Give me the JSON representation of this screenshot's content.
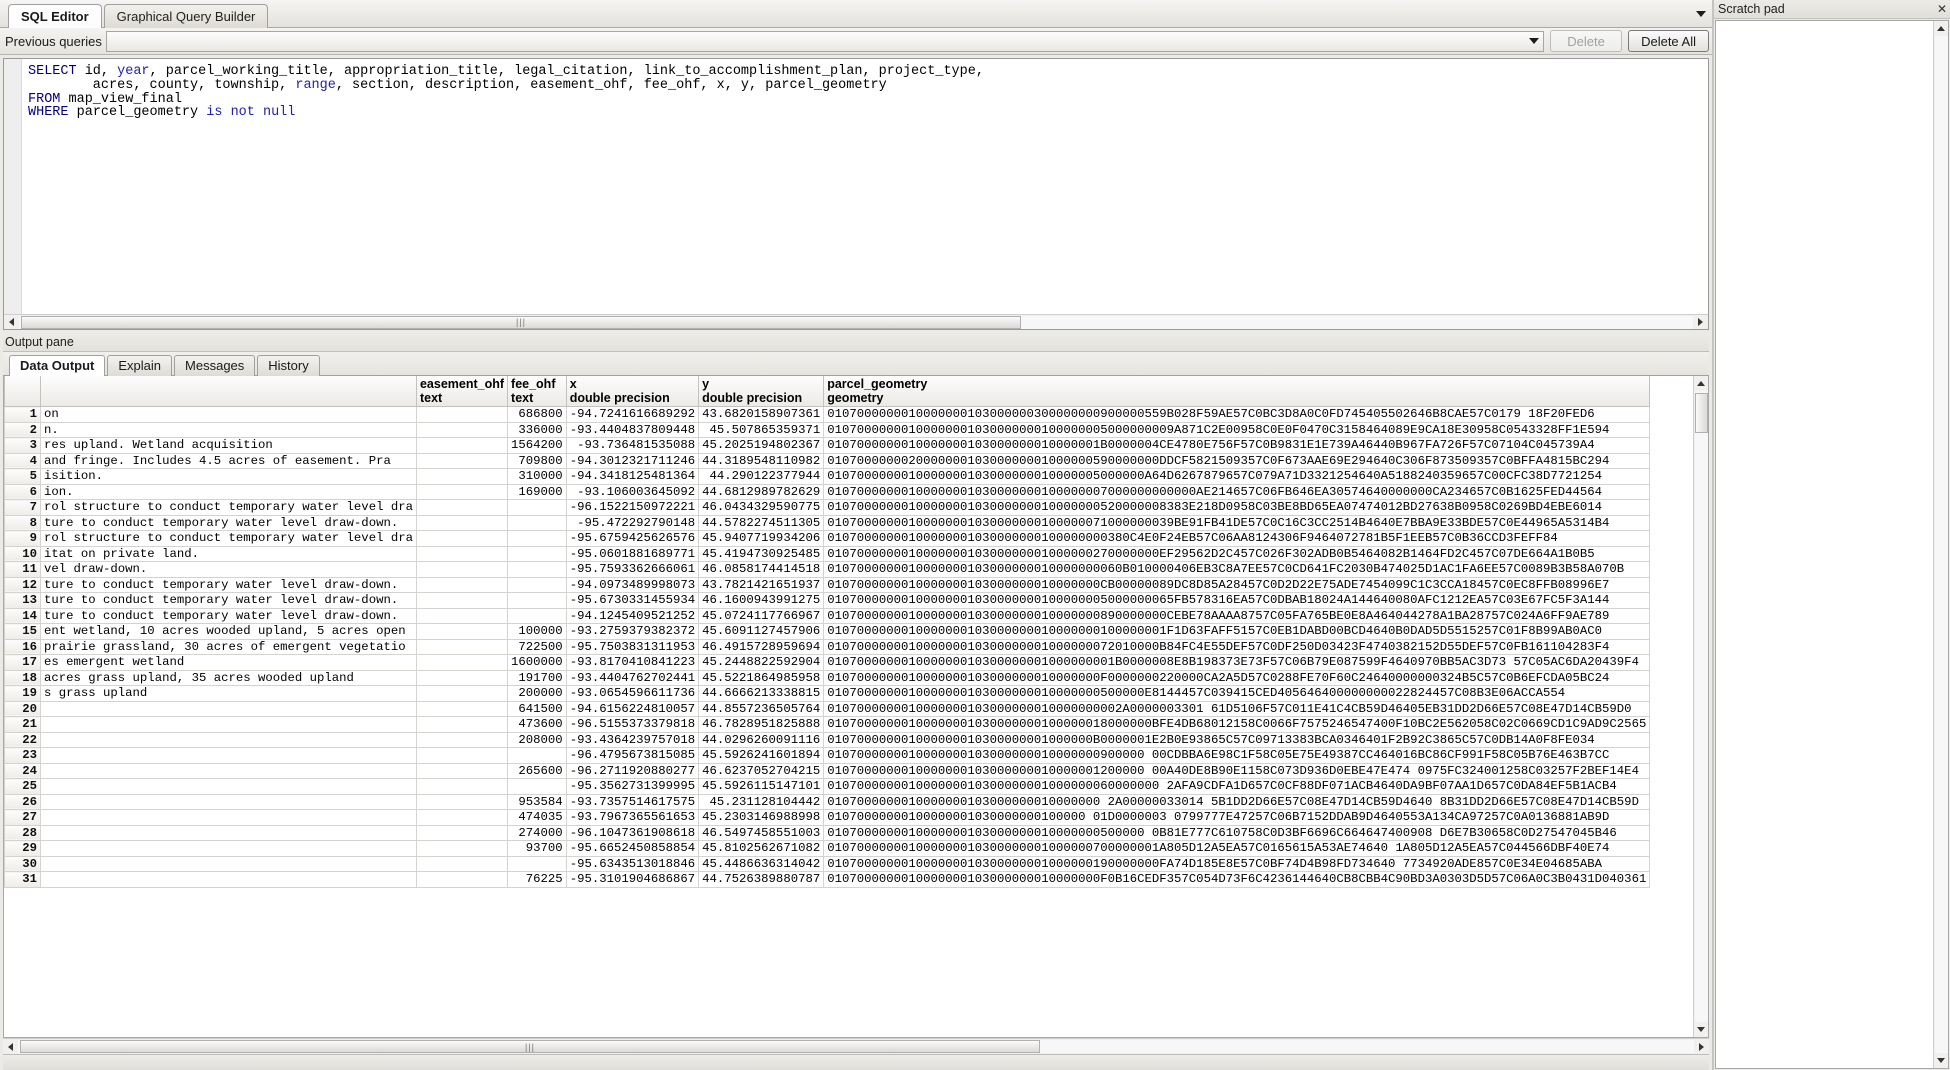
{
  "window": {
    "tabs": [
      {
        "label": "SQL Editor",
        "active": true
      },
      {
        "label": "Graphical Query Builder",
        "active": false
      }
    ],
    "tab_overflow_icon": "chevron-down-icon"
  },
  "toolbar": {
    "previous_queries_label": "Previous queries",
    "previous_queries_value": "",
    "dropdown_icon": "chevron-down-icon",
    "delete_label": "Delete",
    "delete_all_label": "Delete All"
  },
  "editor": {
    "lines": [
      [
        {
          "t": "SELECT",
          "c": "kw"
        },
        {
          "t": " id, ",
          "c": ""
        },
        {
          "t": "year",
          "c": "kw2"
        },
        {
          "t": ", parcel_working_title, appropriation_title, legal_citation, link_to_accomplishment_plan, project_type,",
          "c": ""
        }
      ],
      [
        {
          "t": "        acres, county, township, ",
          "c": ""
        },
        {
          "t": "range",
          "c": "kw2"
        },
        {
          "t": ", section, description, easement_ohf, fee_ohf, x, y, parcel_geometry",
          "c": ""
        }
      ],
      [
        {
          "t": "FROM",
          "c": "kw"
        },
        {
          "t": " map_view_final",
          "c": ""
        }
      ],
      [
        {
          "t": "WHERE",
          "c": "kw"
        },
        {
          "t": " parcel_geometry ",
          "c": ""
        },
        {
          "t": "is",
          "c": "kw2"
        },
        {
          "t": " ",
          "c": ""
        },
        {
          "t": "not",
          "c": "kw2"
        },
        {
          "t": " ",
          "c": ""
        },
        {
          "t": "null",
          "c": "kw2"
        }
      ]
    ],
    "scroll_grip": "|||"
  },
  "output": {
    "pane_title": "Output pane",
    "tabs": [
      {
        "label": "Data Output",
        "active": true
      },
      {
        "label": "Explain",
        "active": false
      },
      {
        "label": "Messages",
        "active": false
      },
      {
        "label": "History",
        "active": false
      }
    ]
  },
  "grid": {
    "columns": [
      {
        "name": "",
        "type": ""
      },
      {
        "name": "",
        "type": ""
      },
      {
        "name": "easement_ohf",
        "type": "text"
      },
      {
        "name": "fee_ohf",
        "type": "text"
      },
      {
        "name": "x",
        "type": "double precision"
      },
      {
        "name": "y",
        "type": "double precision"
      },
      {
        "name": "parcel_geometry",
        "type": "geometry"
      }
    ],
    "rows": [
      {
        "n": "1",
        "desc": "on",
        "easement": "",
        "fee": "686800",
        "x": "-94.7241616689292",
        "y": "43.6820158907361",
        "geom": "0107000000010000000103000000300000000900000559B028F59AE57C0BC3D8A0C0FD745405502646B8CAE57C0179 18F20FED6"
      },
      {
        "n": "2",
        "desc": "n.",
        "easement": "",
        "fee": "336000",
        "x": "-93.4404837809448",
        "y": "45.507865359371",
        "geom": "01070000000100000001030000000100000005000000009A871C2E00958C0E0F0470C3158464089E9CA18E30958C0543328FF1E594"
      },
      {
        "n": "3",
        "desc": "res upland.  Wetland acquisition",
        "easement": "",
        "fee": "1564200",
        "x": "-93.736481535088",
        "y": "45.2025194802367",
        "geom": "0107000000010000000103000000010000001B0000004CE4780E756F57C0B9831E1E739A46440B967FA726F57C07104C045739A4"
      },
      {
        "n": "4",
        "desc": "and fringe.  Includes 4.5 acres of easement.  Pra",
        "easement": "",
        "fee": "709800",
        "x": "-94.3012321711246",
        "y": "44.3189548110982",
        "geom": "010700000002000000010300000001000000590000000DDCF5821509357C0F673AAE69E294640C306F873509357C0BFFA4815BC294"
      },
      {
        "n": "5",
        "desc": "isition.",
        "easement": "",
        "fee": "310000",
        "x": "-94.3418125481364",
        "y": "44.290122377944",
        "geom": "0107000000010000000103000000010000005000000A64D6267879657C079A71D3321254640A5188240359657C00CFC38D7721254"
      },
      {
        "n": "6",
        "desc": "ion.",
        "easement": "",
        "fee": "169000",
        "x": "-93.106003645092",
        "y": "44.6812989782629",
        "geom": "01070000000100000001030000000100000007000000000000AE214657C06FB646EA30574640000000CA234657C0B1625FED44564"
      },
      {
        "n": "7",
        "desc": "rol structure to conduct temporary water level dra",
        "easement": "",
        "fee": "",
        "x": "-96.1522150972221",
        "y": "46.0434329590775",
        "geom": "0107000000010000000103000000010000000520000008383E218D0958C03BE8BD65EA07474012BD27638B0958C0269BD4EBE6014"
      },
      {
        "n": "8",
        "desc": "ture to conduct temporary water level draw-down.",
        "easement": "",
        "fee": "",
        "x": "-95.472292790148",
        "y": "44.5782274511305",
        "geom": "01070000000100000001030000000100000071000000039BE91FB41DE57C0C16C3CC2514B4640E7BBA9E33BDE57C0E44965A5314B4"
      },
      {
        "n": "9",
        "desc": "rol structure to conduct temporary water level dra",
        "easement": "",
        "fee": "",
        "x": "-95.6759425626576",
        "y": "45.9407719934206",
        "geom": "01070000000100000001030000000100000000380C4E0F24EB57C06AA8124306F9464072781B5F1EEB57C0B36CCD3FEFF84"
      },
      {
        "n": "10",
        "desc": "itat on private land.",
        "easement": "",
        "fee": "",
        "x": "-95.0601881689771",
        "y": "45.4194730925485",
        "geom": "010700000001000000010300000001000000270000000EF29562D2C457C026F302ADB0B5464082B1464FD2C457C07DE664A1B0B5"
      },
      {
        "n": "11",
        "desc": "vel draw-down.",
        "easement": "",
        "fee": "",
        "x": "-95.7593362666061",
        "y": "46.0858174414518",
        "geom": "0107000000010000000103000000010000000060B010000406EB3C8A7EE57C0CD641FC2030B474025D1AC1FA6EE57C0089B3B58A070B"
      },
      {
        "n": "12",
        "desc": "ture to conduct temporary water level draw-down.",
        "easement": "",
        "fee": "",
        "x": "-94.0973489998073",
        "y": "43.7821421651937",
        "geom": "0107000000010000000103000000010000000CB00000089DC8D85A28457C0D2D22E75ADE7454099C1C3CCA18457C0EC8FFB08996E7"
      },
      {
        "n": "13",
        "desc": "ture to conduct temporary water level draw-down.",
        "easement": "",
        "fee": "",
        "x": "-95.6730331455934",
        "y": "46.1600943991275",
        "geom": "01070000000100000001030000000100000005000000065FB578316EA57C0DBAB18024A144640080AFC1212EA57C03E67FC5F3A144"
      },
      {
        "n": "14",
        "desc": "ture to conduct temporary water level draw-down.",
        "easement": "",
        "fee": "",
        "x": "-94.1245409521252",
        "y": "45.0724117766967",
        "geom": "0107000000010000000103000000010000000890000000CEBE78AAAA8757C05FA765BE0E8A464044278A1BA28757C024A6FF9AE789"
      },
      {
        "n": "15",
        "desc": "ent wetland, 10 acres wooded upland, 5 acres open",
        "easement": "",
        "fee": "100000",
        "x": "-93.2759379382372",
        "y": "45.6091127457906",
        "geom": "0107000000010000000103000000010000000100000001F1D63FAFF5157C0EB1DABD00BCD4640B0DAD5D5515257C01F8B99AB0AC0"
      },
      {
        "n": "16",
        "desc": " prairie grassland, 30 acres of emergent vegetatio",
        "easement": "",
        "fee": "722500",
        "x": "-95.7503831311953",
        "y": "46.4915728959694",
        "geom": "010700000001000000010300000001000000072010000B84FC4E55DEF57C0DF250D03423F4740382152D55DEF57C0FB161104283F4"
      },
      {
        "n": "17",
        "desc": "es emergent wetland",
        "easement": "",
        "fee": "1600000",
        "x": "-93.8170410841223",
        "y": "45.2448822592904",
        "geom": "010700000001000000010300000001000000001B0000008E8B198373E73F57C06B79E087599F4640970BB5AC3D73 57C05AC6DA20439F4"
      },
      {
        "n": "18",
        "desc": "acres grass upland, 35 acres wooded upland",
        "easement": "",
        "fee": "191700",
        "x": "-93.4404762702441",
        "y": "45.5221864985958",
        "geom": "0107000000010000000103000000010000000F0000000220000CA2A5D57C0288FE70F60C24640000000324B5C57C0B6EFCDA05BC24"
      },
      {
        "n": "19",
        "desc": "s grass upland",
        "easement": "",
        "fee": "200000",
        "x": "-93.0654596611736",
        "y": "44.6666213338815",
        "geom": "0107000000010000000103000000010000000500000E8144457C039415CED405646400000000022824457C08B3E06ACCA554"
      },
      {
        "n": "20",
        "desc": "",
        "easement": "",
        "fee": "641500",
        "x": "-94.6156224810057",
        "y": "44.8557236505764",
        "geom": "0107000000010000000103000000010000000002A0000003301 61D5106F57C011E41C4CB59D46405EB31DD2D66E57C08E47D14CB59D0"
      },
      {
        "n": "21",
        "desc": "",
        "easement": "",
        "fee": "473600",
        "x": "-96.5155373379818",
        "y": "46.7828951825888",
        "geom": "01070000000100000001030000000100000018000000BFE4DB68012158C0066F7575246547400F10BC2E562058C02C0669CD1C9AD9C2565"
      },
      {
        "n": "22",
        "desc": "",
        "easement": "",
        "fee": "208000",
        "x": "-93.4364239757018",
        "y": "44.0296260091116",
        "geom": "010700000001000000010300000001000000B0000001E2B0E93865C57C09713383BCA0346401F2B92C3865C57C0DB14A0F8FE034"
      },
      {
        "n": "23",
        "desc": "",
        "easement": "",
        "fee": "",
        "x": "-96.4795673815085",
        "y": "45.5926241601894",
        "geom": "0107000000010000000103000000010000000900000 00CDBBA6E98C1F58C05E75E49387CC464016BC86CF991F58C05B76E463B7CC"
      },
      {
        "n": "24",
        "desc": "",
        "easement": "",
        "fee": "265600",
        "x": "-96.2711920880277",
        "y": "46.6237052704215",
        "geom": "0107000000010000000103000000010000001200000 00A40DE8B90E1158C073D936D0EBE47E474 0975FC324001258C03257F2BEF14E4"
      },
      {
        "n": "25",
        "desc": "",
        "easement": "",
        "fee": "",
        "x": "-95.3562731399995",
        "y": "45.5926115147101",
        "geom": "010700000001000000010300000001000000060000000 2AFA9CDFA1D657C0CF88DF071ACB4640DA9BF07AA1D657C0DA84EF5B1ACB4"
      },
      {
        "n": "26",
        "desc": "",
        "easement": "",
        "fee": "953584",
        "x": "-93.7357514617575",
        "y": "45.231128104442",
        "geom": "0107000000010000000103000000010000000 2A00000033014 5B1DD2D66E57C08E47D14CB59D4640 8B31DD2D66E57C08E47D14CB59D"
      },
      {
        "n": "27",
        "desc": "",
        "easement": "",
        "fee": "474035",
        "x": "-93.7967365561653",
        "y": "45.2303146988998",
        "geom": "01070000000100000001030000000100000 01D0000003 0799777E47257C06B7152DDAB9D4640553A134CA97257C0A0136881AB9D"
      },
      {
        "n": "28",
        "desc": "",
        "easement": "",
        "fee": "274000",
        "x": "-96.1047361908618",
        "y": "46.5497458551003",
        "geom": "0107000000010000000103000000010000000500000 0B81E777C610758C0D3BF6696C664647400908 D6E7B30658C0D27547045B46"
      },
      {
        "n": "29",
        "desc": "",
        "easement": "",
        "fee": "93700",
        "x": "-95.6652450858854",
        "y": "45.8102562671082",
        "geom": "010700000001000000010300000001000000700000001A805D12A5EA57C0165615A53AE74640 1A805D12A5EA57C044566DBF40E74"
      },
      {
        "n": "30",
        "desc": "",
        "easement": "",
        "fee": "",
        "x": "-95.6343513018846",
        "y": "45.4486636314042",
        "geom": "010700000001000000010300000001000000190000000FA74D185E8E57C0BF74D4B98FD734640 7734920ADE857C0E34E04685ABA"
      },
      {
        "n": "31",
        "desc": "",
        "easement": "",
        "fee": "76225",
        "x": "-95.3101904686867",
        "y": "44.7526389880787",
        "geom": "0107000000010000000103000000010000000F0B16CEDF357C054D73F6C4236144640CB8CBB4C90BD3A0303D5D57C06A0C3B0431D040361"
      }
    ]
  },
  "scratchpad": {
    "title": "Scratch pad",
    "close_icon": "close-icon",
    "content": ""
  }
}
